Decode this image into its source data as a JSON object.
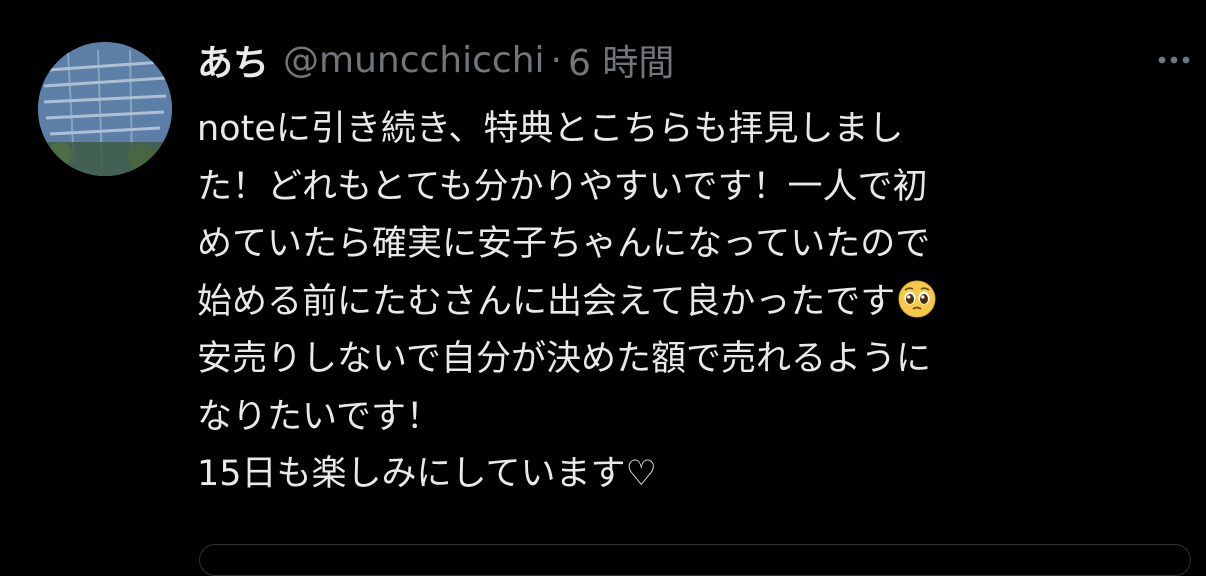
{
  "tweet": {
    "author": {
      "display_name": "あち",
      "handle": "@muncchicchi",
      "avatar_icon": "avatar-photo-icon"
    },
    "separator": "·",
    "timestamp": "6 時間",
    "more_icon": "more-horizontal-icon",
    "text_lines": [
      "noteに引き続き、特典とこちらも拝見しまし",
      "た！どれもとても分かりやすいです！一人で初",
      "めていたら確実に安子ちゃんになっていたので",
      "始める前にたむさんに出会えて良かったです",
      "安売りしないで自分が決めた額で売れるように",
      "なりたいです！",
      "15日も楽しみにしています♡"
    ],
    "emoji_icon": "pleading-face-emoji-icon"
  },
  "colors": {
    "background": "#000000",
    "primary_text": "#e7e9ea",
    "secondary_text": "#71767b",
    "border": "#2f3336"
  }
}
